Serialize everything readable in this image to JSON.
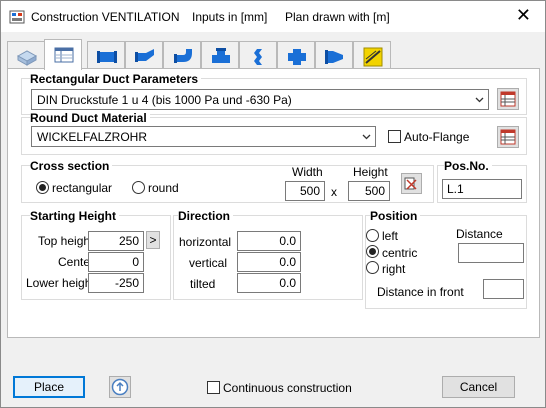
{
  "window": {
    "title_app": "Construction VENTILATION",
    "title_units": "Inputs in [mm]",
    "title_plan": "Plan drawn with  [m]"
  },
  "tabs": [
    {
      "icon": "duct-3d-icon"
    },
    {
      "icon": "parameters-table-icon"
    },
    {
      "icon": "straight-duct-icon"
    },
    {
      "icon": "bend-duct-icon"
    },
    {
      "icon": "elbow-duct-icon"
    },
    {
      "icon": "tee-duct-icon"
    },
    {
      "icon": "reducer-duct-icon"
    },
    {
      "icon": "cross-duct-icon"
    },
    {
      "icon": "transition-duct-icon"
    },
    {
      "icon": "sloped-duct-icon"
    }
  ],
  "rect_duct": {
    "label": "Rectangular Duct Parameters",
    "value": "DIN Druckstufe 1 u 4 (bis 1000 Pa und -630 Pa)"
  },
  "round_duct": {
    "label": "Round Duct Material",
    "value": "WICKELFALZROHR",
    "auto_flange_label": "Auto-Flange",
    "auto_flange_checked": false
  },
  "cross_section": {
    "label": "Cross section",
    "option_rect": "rectangular",
    "option_round": "round",
    "selected": "rectangular",
    "width_label": "Width",
    "height_label": "Height",
    "width": "500",
    "x_sep": "x",
    "height": "500"
  },
  "pos_no": {
    "label": "Pos.No.",
    "value": "L.1"
  },
  "starting_height": {
    "label": "Starting Height",
    "top_label": "Top height",
    "top": "250",
    "arrow_label": ">",
    "center_label": "Center",
    "center": "0",
    "lower_label": "Lower height",
    "lower": "-250"
  },
  "direction": {
    "label": "Direction",
    "horizontal_label": "horizontal",
    "horizontal": "0.0",
    "vertical_label": "vertical",
    "vertical": "0.0",
    "tilted_label": "tilted",
    "tilted": "0.0"
  },
  "position": {
    "label": "Position",
    "left_label": "left",
    "centric_label": "centric",
    "right_label": "right",
    "selected": "centric",
    "distance_label": "Distance",
    "distance": "",
    "front_label": "Distance in front",
    "front": ""
  },
  "footer": {
    "place_label": "Place",
    "continuous_label": "Continuous construction",
    "continuous_checked": false,
    "cancel_label": "Cancel"
  },
  "colors": {
    "accent": "#0078d7",
    "duct_blue": "#1a6fd6",
    "sloped_yellow": "#f2d300"
  }
}
